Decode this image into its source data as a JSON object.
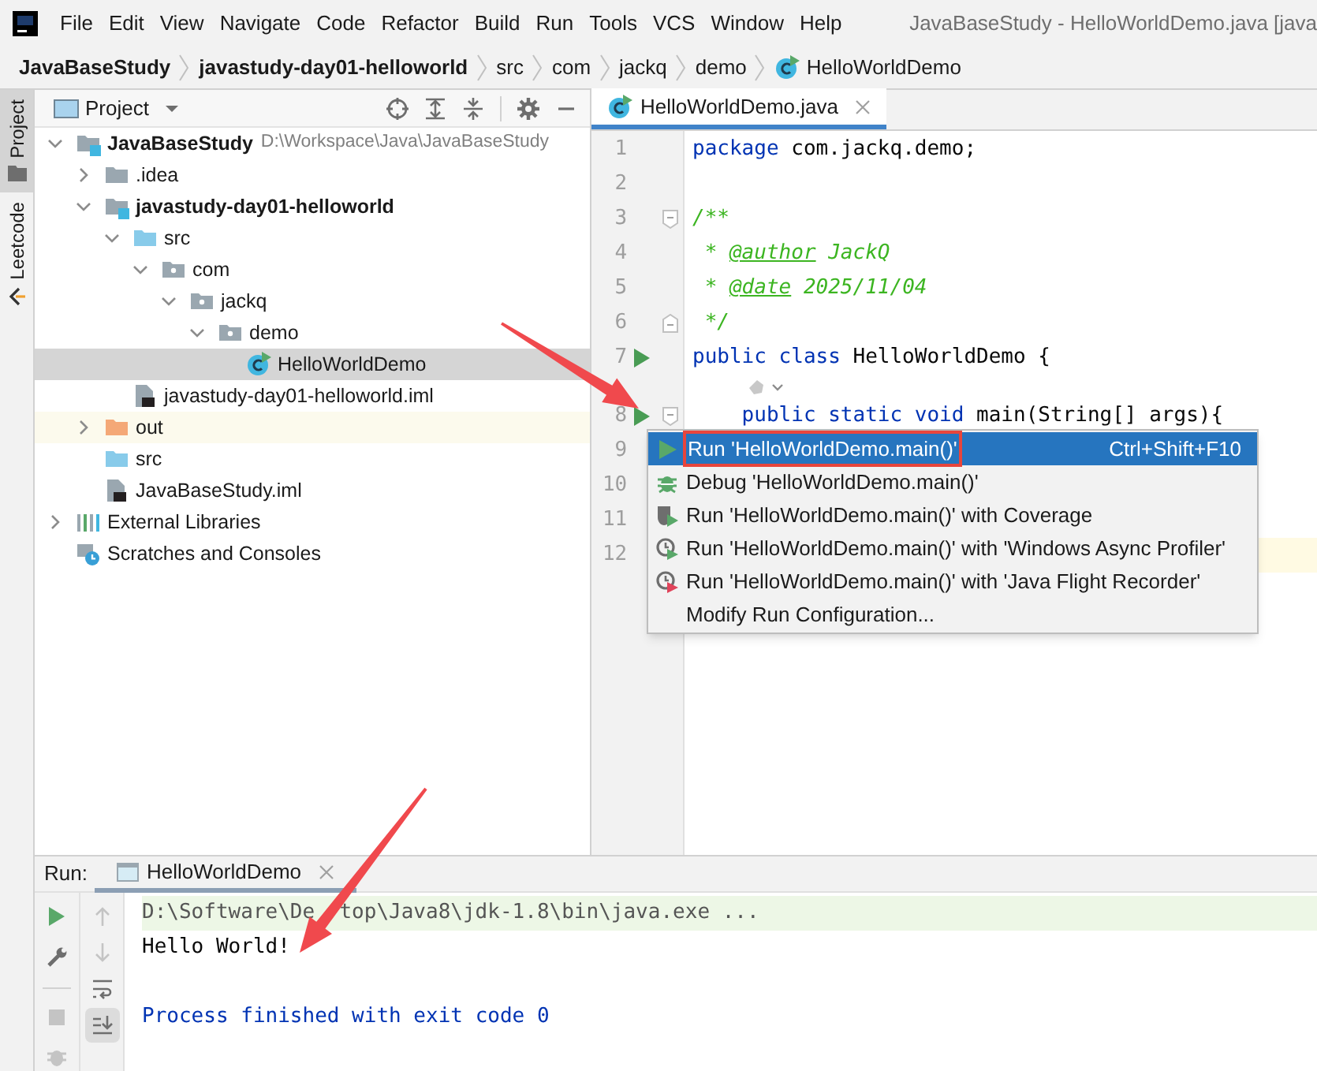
{
  "window": {
    "title": "JavaBaseStudy - HelloWorldDemo.java [java"
  },
  "menu": [
    "File",
    "Edit",
    "View",
    "Navigate",
    "Code",
    "Refactor",
    "Build",
    "Run",
    "Tools",
    "VCS",
    "Window",
    "Help"
  ],
  "breadcrumb": [
    {
      "label": "JavaBaseStudy",
      "kind": "module"
    },
    {
      "label": "javastudy-day01-helloworld",
      "kind": "module"
    },
    {
      "label": "src",
      "kind": "folder"
    },
    {
      "label": "com",
      "kind": "folder"
    },
    {
      "label": "jackq",
      "kind": "folder"
    },
    {
      "label": "demo",
      "kind": "folder"
    },
    {
      "label": "HelloWorldDemo",
      "kind": "class"
    }
  ],
  "side_tabs": [
    {
      "label": "Project",
      "kind": "project",
      "selected": true
    },
    {
      "label": "Leetcode",
      "kind": "leetcode",
      "selected": false
    }
  ],
  "project_panel": {
    "title": "Project",
    "tree": [
      {
        "label": "JavaBaseStudy",
        "kind": "module",
        "hint": "D:\\Workspace\\Java\\JavaBaseStudy",
        "expanded": true,
        "selected": false,
        "children": [
          {
            "label": ".idea",
            "kind": "folder",
            "expanded": false,
            "selected": false
          },
          {
            "label": "javastudy-day01-helloworld",
            "kind": "module",
            "expanded": true,
            "selected": false,
            "children": [
              {
                "label": "src",
                "kind": "source-folder",
                "expanded": true,
                "selected": false,
                "children": [
                  {
                    "label": "com",
                    "kind": "package",
                    "expanded": true,
                    "selected": false,
                    "children": [
                      {
                        "label": "jackq",
                        "kind": "package",
                        "expanded": true,
                        "selected": false,
                        "children": [
                          {
                            "label": "demo",
                            "kind": "package",
                            "expanded": true,
                            "selected": false,
                            "children": [
                              {
                                "label": "HelloWorldDemo",
                                "kind": "class",
                                "selected": true
                              }
                            ]
                          }
                        ]
                      }
                    ]
                  }
                ]
              },
              {
                "label": "javastudy-day01-helloworld.iml",
                "kind": "iml",
                "selected": false
              }
            ]
          },
          {
            "label": "out",
            "kind": "excluded-folder",
            "expanded": false,
            "selected": false
          },
          {
            "label": "src",
            "kind": "source-folder",
            "selected": false
          },
          {
            "label": "JavaBaseStudy.iml",
            "kind": "iml",
            "selected": false
          }
        ]
      },
      {
        "label": "External Libraries",
        "kind": "libraries",
        "expanded": false,
        "selected": false
      },
      {
        "label": "Scratches and Consoles",
        "kind": "scratches",
        "selected": false
      }
    ]
  },
  "editor": {
    "tabs": [
      {
        "label": "HelloWorldDemo.java",
        "selected": true
      }
    ],
    "lines": [
      {
        "number": "1",
        "code": [
          {
            "text": "package",
            "kind": "keyword"
          },
          {
            "text": " com.jackq.demo;",
            "kind": "plain"
          }
        ],
        "run": false,
        "fold_open": false,
        "fold_close": false,
        "current": false,
        "inlay": false
      },
      {
        "number": "2",
        "run": false,
        "fold_open": false,
        "fold_close": false,
        "current": false,
        "inlay": false
      },
      {
        "number": "3",
        "code": [
          {
            "text": "/**",
            "kind": "comment"
          }
        ],
        "run": false,
        "fold_open": true,
        "fold_close": false,
        "current": false,
        "inlay": false
      },
      {
        "number": "4",
        "code": [
          {
            "text": " * ",
            "kind": "comment"
          },
          {
            "text": "@author",
            "kind": "doc-tag"
          },
          {
            "text": " JackQ",
            "kind": "comment"
          }
        ],
        "run": false,
        "fold_open": false,
        "fold_close": false,
        "current": false,
        "inlay": false
      },
      {
        "number": "5",
        "code": [
          {
            "text": " * ",
            "kind": "comment"
          },
          {
            "text": "@date",
            "kind": "doc-tag"
          },
          {
            "text": " 2025/11/04",
            "kind": "comment"
          }
        ],
        "run": false,
        "fold_open": false,
        "fold_close": false,
        "current": false,
        "inlay": false
      },
      {
        "number": "6",
        "code": [
          {
            "text": " */",
            "kind": "comment"
          }
        ],
        "run": false,
        "fold_open": false,
        "fold_close": true,
        "current": false,
        "inlay": false
      },
      {
        "number": "7",
        "code": [
          {
            "text": "public class",
            "kind": "keyword"
          },
          {
            "text": " HelloWorldDemo {",
            "kind": "plain"
          }
        ],
        "run": true,
        "fold_open": false,
        "fold_close": false,
        "current": false,
        "inlay": true
      },
      {
        "number": "8",
        "code": [
          {
            "text": "    public static void",
            "kind": "keyword"
          },
          {
            "text": " main(String[] args){",
            "kind": "plain"
          }
        ],
        "run": true,
        "fold_open": true,
        "fold_close": false,
        "current": false,
        "inlay": false
      },
      {
        "number": "9",
        "run": false,
        "fold_open": false,
        "fold_close": false,
        "current": false,
        "inlay": false
      },
      {
        "number": "10",
        "run": false,
        "fold_open": false,
        "fold_close": false,
        "current": false,
        "inlay": false
      },
      {
        "number": "11",
        "run": false,
        "fold_open": false,
        "fold_close": false,
        "current": false,
        "inlay": false
      },
      {
        "number": "12",
        "run": false,
        "fold_open": false,
        "fold_close": false,
        "current": true,
        "inlay": false
      }
    ]
  },
  "context_menu": {
    "items": [
      {
        "label": "Run 'HelloWorldDemo.main()'",
        "shortcut": "Ctrl+Shift+F10",
        "kind": "run",
        "selected": true,
        "highlighted": true
      },
      {
        "label": "Debug 'HelloWorldDemo.main()'",
        "kind": "debug",
        "selected": false,
        "highlighted": false
      },
      {
        "label": "Run 'HelloWorldDemo.main()' with Coverage",
        "kind": "coverage",
        "selected": false,
        "highlighted": false
      },
      {
        "label": "Run 'HelloWorldDemo.main()' with 'Windows Async Profiler'",
        "kind": "profiler",
        "selected": false,
        "highlighted": false
      },
      {
        "label": "Run 'HelloWorldDemo.main()' with 'Java Flight Recorder'",
        "kind": "recorder",
        "selected": false,
        "highlighted": false
      },
      {
        "label": "Modify Run Configuration...",
        "kind": "plain",
        "selected": false,
        "highlighted": false
      }
    ]
  },
  "run_panel": {
    "label": "Run:",
    "tabs": [
      {
        "label": "HelloWorldDemo",
        "selected": true
      }
    ],
    "console": [
      {
        "parts": [
          "D:\\Software\\De",
          "top\\Java8\\jdk-1.8\\bin\\java.exe ..."
        ],
        "kind": "command"
      },
      {
        "parts": [
          "Hello World!"
        ],
        "kind": "output"
      },
      {
        "kind": "blank"
      },
      {
        "parts": [
          "Process finished with exit code 0"
        ],
        "kind": "exit"
      }
    ]
  }
}
